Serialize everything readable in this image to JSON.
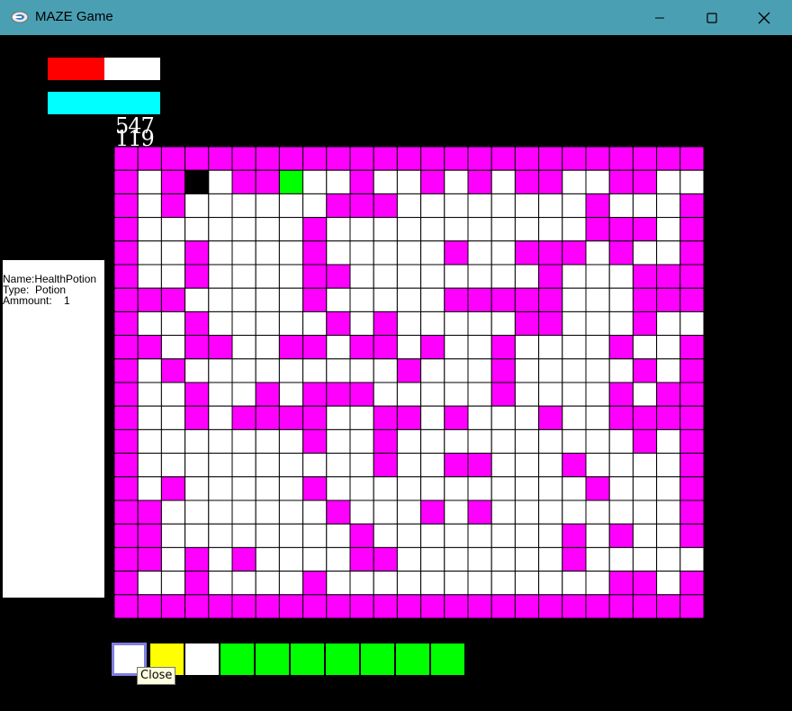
{
  "window": {
    "title": "MAZE Game",
    "icon": "maze-app-icon",
    "buttons": [
      "minimize-icon",
      "maximize-icon",
      "close-icon"
    ]
  },
  "hud": {
    "health": {
      "fraction": 0.5,
      "color": "#ff0000",
      "empty_color": "#ffffff"
    },
    "mana": {
      "fraction": 1.0,
      "color": "#00ffff"
    },
    "stat_1": "547",
    "stat_2": "119"
  },
  "item_info": {
    "name_line": "Name:HealthPotion",
    "type_line": "Type:  Potion",
    "amount_line": "Ammount:    1"
  },
  "maze": {
    "cols": 25,
    "rows": 20,
    "colors": {
      "W": "#ff00ff",
      ".": "#ffffff",
      "P": "#000000",
      "G": "#00ff00"
    },
    "legend": {
      "W": "wall",
      ".": "floor",
      "P": "player",
      "G": "goal"
    },
    "grid": [
      "WWWWWWWWWWWWWWWWWWWWWWWWW",
      "W.WP.WWG..W..W.W.WW..WW..",
      "W.W......WWW........W...W",
      "W.......W...........WWW.W",
      "W..W....W.....W..WWW.W..W",
      "W..W....WW........W...WWW",
      "WWW.....W.....WWWWW...WWW",
      "W..W.....W.W.....WW...W..",
      "WW.WW..WW.WW.W..W....W..W",
      "W.W.........W...W.....W.W",
      "W..W..W.WWW.....W....W.WW",
      "W..W.WWWW..WW.W...W..WWWW",
      "W.......W..W..........W.W",
      "W..........W..WW...W....W",
      "W.W.....W...........W...W",
      "WW.......W...W.W........W",
      "WW........W........W.W..W",
      "WW.W.W....WW.......W.....",
      "W..W....W............WW.W",
      "WWWWWWWWWWWWWWWWWWWWWWWWW"
    ]
  },
  "inventory": {
    "slots": [
      {
        "color": "#ffffff",
        "selected": true
      },
      {
        "color": "#ffff00",
        "selected": false
      },
      {
        "color": "#ffffff",
        "selected": false
      },
      {
        "color": "#00ff00",
        "selected": false
      },
      {
        "color": "#00ff00",
        "selected": false
      },
      {
        "color": "#00ff00",
        "selected": false
      },
      {
        "color": "#00ff00",
        "selected": false
      },
      {
        "color": "#00ff00",
        "selected": false
      },
      {
        "color": "#00ff00",
        "selected": false
      },
      {
        "color": "#00ff00",
        "selected": false
      }
    ]
  },
  "tooltip": {
    "text": "Close"
  }
}
